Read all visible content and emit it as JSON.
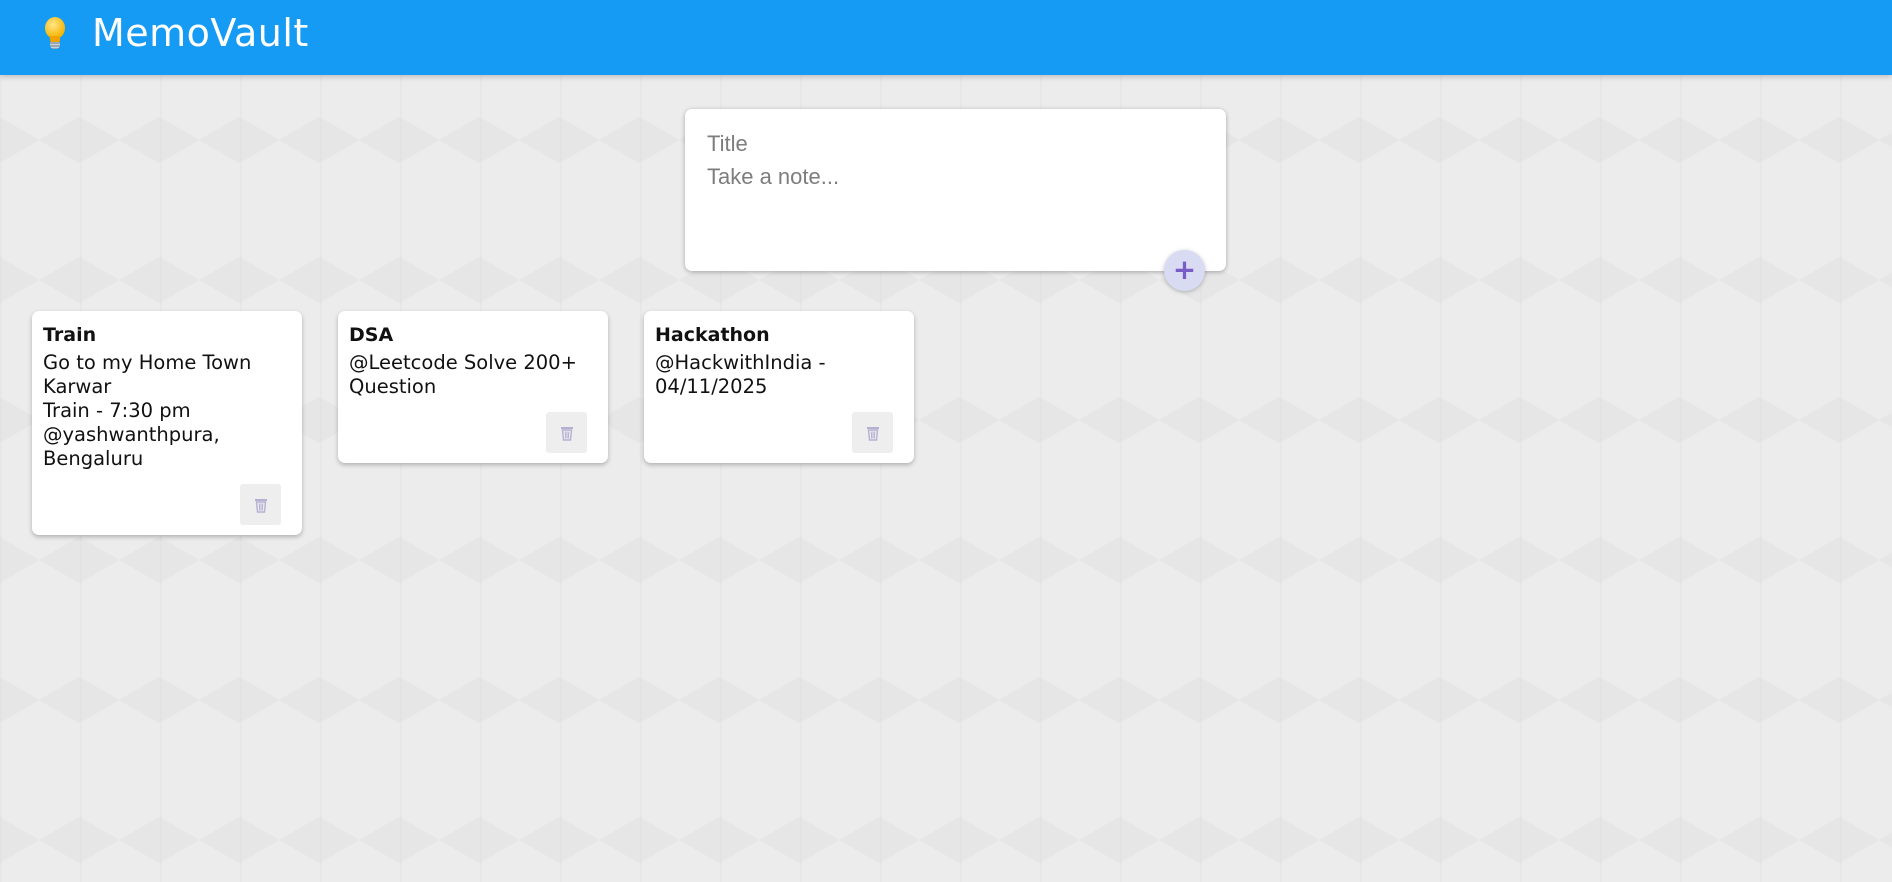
{
  "header": {
    "app_title": "MemoVault",
    "logo_icon": "lightbulb-icon",
    "color": "#169bf4"
  },
  "composer": {
    "title_placeholder": "Title",
    "title_value": "",
    "note_placeholder": "Take a note...",
    "note_value": "",
    "add_icon": "plus-icon",
    "add_label": "+"
  },
  "notes": [
    {
      "title": "Train",
      "content": "Go to my Home Town Karwar\nTrain - 7:30 pm @yashwanthpura, Bengaluru",
      "delete_icon": "trash-icon"
    },
    {
      "title": "DSA",
      "content": "@Leetcode Solve 200+ Question",
      "delete_icon": "trash-icon"
    },
    {
      "title": "Hackathon",
      "content": "@HackwithIndia - 04/11/2025",
      "delete_icon": "trash-icon"
    }
  ],
  "colors": {
    "accent": "#169bf4",
    "add_button": "#d9dbf2",
    "add_icon": "#7a5cc7",
    "background": "#ececec"
  }
}
